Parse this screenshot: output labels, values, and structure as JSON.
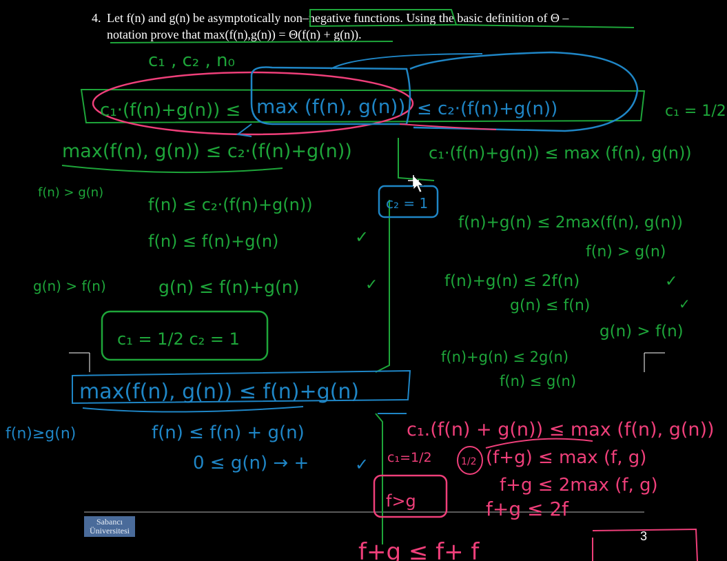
{
  "slide": {
    "problem_number": "4.",
    "line1": "Let f(n) and g(n) be asymptotically non–negative functions. Using the basic definition of Θ –",
    "line2": "notation prove that max(f(n),g(n)) = Θ(f(n) + g(n)).",
    "page_number": "3",
    "logo_line1": "Sabancı",
    "logo_line2": "Üniversitesi"
  },
  "annotations": {
    "consts": "c₁ , c₂ , n₀",
    "main_left": "c₁·(f(n)+g(n)) ≤",
    "main_mid": "max (f(n), g(n))",
    "main_right": "≤ c₂·(f(n)+g(n))",
    "c1_half": "c₁ = 1/2",
    "upper": "max(f(n), g(n)) ≤ c₂·(f(n)+g(n))",
    "lower": "c₁·(f(n)+g(n)) ≤ max (f(n), g(n))",
    "case_f": "f(n) > g(n)",
    "u1": "f(n)  ≤  c₂·(f(n)+g(n))",
    "u2": "f(n)  ≤  f(n)+g(n)",
    "c2_box": "c₂ = 1",
    "l1": "f(n)+g(n) ≤ 2max(f(n), g(n))",
    "l2": "f(n) > g(n)",
    "l3": "f(n)+g(n) ≤ 2f(n)",
    "l4": "g(n) ≤ f(n)",
    "l5": "g(n) > f(n)",
    "case_g": "g(n) > f(n)",
    "g1": "g(n) ≤ f(n)+g(n)",
    "const_box": "c₁ = 1/2     c₂ = 1",
    "l6": "f(n)+g(n) ≤ 2g(n)",
    "l7": "f(n) ≤ g(n)",
    "blue_max": "max(f(n), g(n)) ≤ f(n)+g(n)",
    "blue_case": "f(n)≥g(n)",
    "blue1": "f(n) ≤ f(n) + g(n)",
    "blue2": "0 ≤ g(n) → +",
    "pink1": "c₁.(f(n) + g(n)) ≤ max (f(n), g(n))",
    "pink_c1": "c₁=1/2",
    "pink_half": "1/2",
    "pink2": "(f+g) ≤ max (f, g)",
    "pink3": "f+g ≤ 2max (f, g)",
    "pink_fg": "f>g",
    "pink4": "f+g ≤ 2f",
    "pink5": "f+g ≤ f+ f",
    "tick": "✓"
  },
  "colors": {
    "background": "#000000",
    "text": "#ffffff",
    "ink_green": "#1ea63a",
    "ink_blue": "#1f86c6",
    "ink_pink": "#ef3f7a"
  }
}
